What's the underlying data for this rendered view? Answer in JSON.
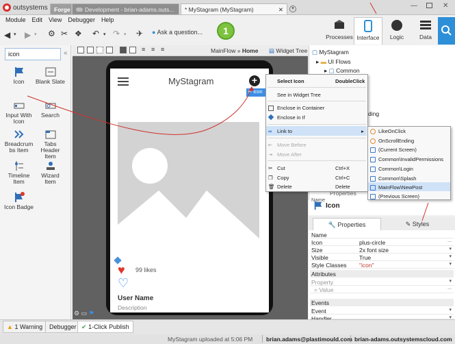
{
  "app": {
    "name": "outsystems"
  },
  "tabs": [
    {
      "label": "Forge"
    },
    {
      "label": "Development - brian-adams.outs..."
    },
    {
      "label": "* MyStagram (MyStagram)"
    }
  ],
  "menu": [
    "Module",
    "Edit",
    "View",
    "Debugger",
    "Help"
  ],
  "toolbar": {
    "ask": "Ask a question...",
    "step": "1"
  },
  "nav": [
    {
      "label": "Processes"
    },
    {
      "label": "Interface"
    },
    {
      "label": "Logic"
    },
    {
      "label": "Data"
    }
  ],
  "palette": {
    "search_value": "icon",
    "widgets": [
      {
        "label": "Icon",
        "icon": "flag-icon"
      },
      {
        "label": "Blank Slate",
        "icon": "blank-slate-icon"
      },
      {
        "label": "Input With Icon",
        "icon": "input-icon"
      },
      {
        "label": "Search",
        "icon": "search-icon"
      },
      {
        "label": "Breadcrum bs Item",
        "icon": "breadcrumbs-icon"
      },
      {
        "label": "Tabs Header Item",
        "icon": "tabs-icon"
      },
      {
        "label": "Timeline Item",
        "icon": "timeline-icon"
      },
      {
        "label": "Wizard Item",
        "icon": "wizard-icon"
      },
      {
        "label": "Icon Badge",
        "icon": "icon-badge-icon"
      }
    ]
  },
  "canvasbar": {
    "breadcrumb_prefix": "MainFlow » ",
    "breadcrumb_current": "Home",
    "widget_tree": "Widget Tree"
  },
  "screen": {
    "title": "MyStagram",
    "likes": "99 likes",
    "user": "User Name",
    "desc": "Description",
    "selected_badge": "Icon"
  },
  "context_menu": {
    "items": [
      {
        "label": "Select Icon",
        "shortcut": "DoubleClick",
        "bold": true
      },
      {
        "label": "See in Widget Tree",
        "shortcut": ""
      },
      {
        "label": "Enclose in Container",
        "shortcut": ""
      },
      {
        "label": "Enclose in If",
        "shortcut": ""
      },
      {
        "label": "Link to",
        "shortcut": ""
      },
      {
        "label": "Move Before",
        "shortcut": "",
        "disabled": true
      },
      {
        "label": "Move After",
        "shortcut": "",
        "disabled": true
      },
      {
        "label": "Cut",
        "shortcut": "Ctrl+X"
      },
      {
        "label": "Copy",
        "shortcut": "Ctrl+C"
      },
      {
        "label": "Delete",
        "shortcut": "Delete"
      }
    ]
  },
  "submenu": {
    "items": [
      {
        "label": "LikeOnClick",
        "kind": "action"
      },
      {
        "label": "OnScrollEnding",
        "kind": "action"
      },
      {
        "label": "(Current Screen)",
        "kind": "page"
      },
      {
        "label": "Common\\InvalidPermissions",
        "kind": "page"
      },
      {
        "label": "Common\\Login",
        "kind": "page"
      },
      {
        "label": "Common\\Splash",
        "kind": "page"
      },
      {
        "label": "MainFlow\\NewPost",
        "kind": "page"
      },
      {
        "label": "(Previous Screen)",
        "kind": "page"
      }
    ]
  },
  "tree": {
    "root": "MyStagram",
    "ui_flows": "UI Flows",
    "common": "Common",
    "partial1": "ding",
    "partial2": "Properties"
  },
  "properties": {
    "widget_title": "Icon",
    "name_label": "Name",
    "tabs": [
      "Properties",
      "Styles"
    ],
    "rows": [
      {
        "k": "Name",
        "v": ""
      },
      {
        "k": "Icon",
        "v": "plus-circle",
        "dd": "..."
      },
      {
        "k": "Size",
        "v": "2x font size",
        "dd": "▾"
      },
      {
        "k": "Visible",
        "v": "True",
        "dd": "▾"
      },
      {
        "k": "Style Classes",
        "v": "\"icon\"",
        "dd": "▾"
      }
    ],
    "attributes_group": "Attributes",
    "attr_rows": [
      {
        "k": "Property",
        "v": "",
        "dd": "▾"
      },
      {
        "k": "= Value",
        "v": "",
        "dd": "..."
      }
    ],
    "events_group": "Events",
    "event_rows": [
      {
        "k": "Event",
        "v": "",
        "dd": "▾"
      },
      {
        "k": "Handler",
        "v": "",
        "dd": "▾"
      }
    ]
  },
  "bottom": {
    "warning": "1 Warning",
    "debugger": "Debugger",
    "publish": "1-Click Publish"
  },
  "status": {
    "uploaded": "MyStagram uploaded at 5:06 PM",
    "user": "brian.adams@plastimould.com",
    "server": "brian-adams.outsystemscloud.com"
  }
}
